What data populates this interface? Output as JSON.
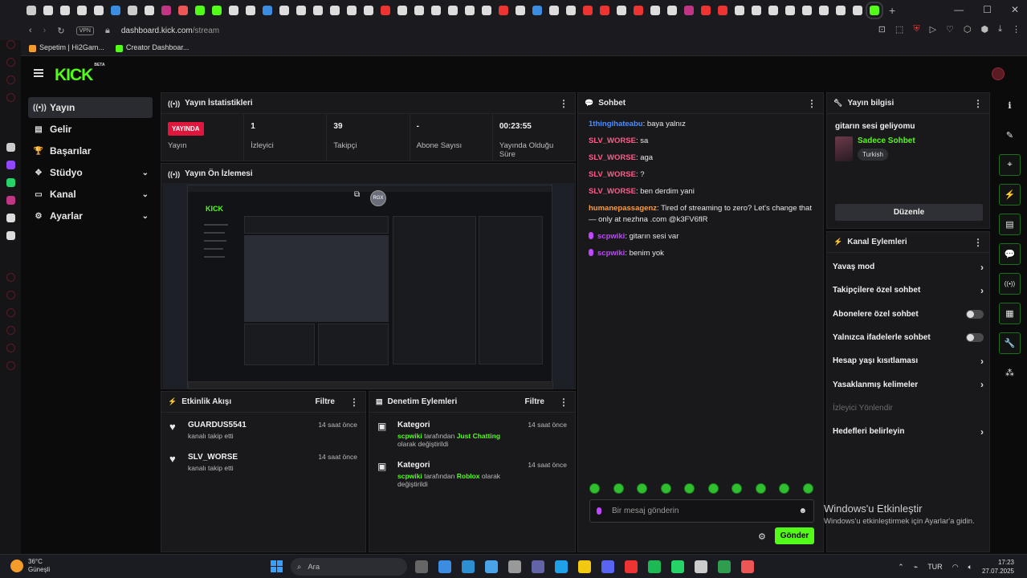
{
  "browser": {
    "vpn": "VPN",
    "url_host": "dashboard.kick.com",
    "url_path": "/stream",
    "bookmarks": [
      {
        "label": "Sepetim | Hi2Gam...",
        "color": "#f39c2b"
      },
      {
        "label": "Creator Dashboar...",
        "color": "#53fc18"
      }
    ],
    "tab_colors": [
      "#ccc",
      "#ddd",
      "#ddd",
      "#ddd",
      "#ddd",
      "#3a8de0",
      "#ccc",
      "#ddd",
      "#c13584",
      "#e55",
      "#53fc18",
      "#53fc18",
      "#ddd",
      "#ddd",
      "#3a8de0",
      "#ddd",
      "#ddd",
      "#ddd",
      "#ddd",
      "#ddd",
      "#ddd",
      "#e33",
      "#ddd",
      "#ddd",
      "#ddd",
      "#ddd",
      "#ddd",
      "#ddd",
      "#e33",
      "#ddd",
      "#3a8de0",
      "#ddd",
      "#ddd",
      "#e33",
      "#e33",
      "#ddd",
      "#e33",
      "#ddd",
      "#ddd",
      "#c13584",
      "#e33",
      "#e33",
      "#ddd",
      "#ddd",
      "#ddd",
      "#ddd",
      "#ddd",
      "#ddd",
      "#ddd",
      "#ddd",
      "#53fc18"
    ]
  },
  "brand": {
    "logo": "KICK",
    "beta": "BETA",
    "accent": "#53fc18",
    "live_color": "#e1163c"
  },
  "nav": [
    {
      "label": "Yayın",
      "icon": "broadcast-icon",
      "glyph": "((•))",
      "active": true,
      "chevron": false
    },
    {
      "label": "Gelir",
      "icon": "revenue-icon",
      "glyph": "▤",
      "active": false,
      "chevron": false
    },
    {
      "label": "Başarılar",
      "icon": "trophy-icon",
      "glyph": "🏆",
      "active": false,
      "chevron": false
    },
    {
      "label": "Stüdyo",
      "icon": "studio-icon",
      "glyph": "✥",
      "active": false,
      "chevron": true
    },
    {
      "label": "Kanal",
      "icon": "channel-icon",
      "glyph": "▭",
      "active": false,
      "chevron": true
    },
    {
      "label": "Ayarlar",
      "icon": "settings-icon",
      "glyph": "⚙",
      "active": false,
      "chevron": true
    }
  ],
  "stats": {
    "title": "Yayın İstatistikleri",
    "live_badge": "YAYINDA",
    "items": [
      {
        "value": "",
        "label": "Yayın"
      },
      {
        "value": "1",
        "label": "İzleyici"
      },
      {
        "value": "39",
        "label": "Takipçi"
      },
      {
        "value": "-",
        "label": "Abone Sayısı"
      },
      {
        "value": "00:23:55",
        "label": "Yayında Olduğu Süre"
      }
    ]
  },
  "preview": {
    "title": "Yayın Ön İzlemesi",
    "avatar_label": "RGX"
  },
  "activity": {
    "title": "Etkinlik Akışı",
    "filter": "Filtre",
    "events": [
      {
        "name": "GUARDUS5541",
        "desc": "kanalı takip etti",
        "time": "14 saat önce"
      },
      {
        "name": "SLV_WORSE",
        "desc": "kanalı takip etti",
        "time": "14 saat önce"
      }
    ]
  },
  "moderation": {
    "title": "Denetim Eylemleri",
    "filter": "Filtre",
    "events": [
      {
        "name": "Kategori",
        "user": "scpwiki",
        "pre": "tarafından",
        "target": "Just Chatting",
        "post": "olarak değiştirildi",
        "time": "14 saat önce"
      },
      {
        "name": "Kategori",
        "user": "scpwiki",
        "pre": "tarafından",
        "target": "Roblox",
        "post": "olarak değiştirildi",
        "time": "14 saat önce"
      }
    ]
  },
  "chat": {
    "title": "Sohbet",
    "messages": [
      {
        "user": "1thingihateabu",
        "color": "#4a8dff",
        "text": "baya yalnız",
        "mic": false
      },
      {
        "user": "SLV_WORSE",
        "color": "#ff5c8a",
        "text": "sa",
        "mic": false
      },
      {
        "user": "SLV_WORSE",
        "color": "#ff5c8a",
        "text": "aga",
        "mic": false
      },
      {
        "user": "SLV_WORSE",
        "color": "#ff5c8a",
        "text": "?",
        "mic": false
      },
      {
        "user": "SLV_WORSE",
        "color": "#ff5c8a",
        "text": "ben derdim yani",
        "mic": false
      },
      {
        "user": "humanepassagenz",
        "color": "#ff9d3a",
        "text": "Tired of streaming to zero? Let's change that — only at nezhna .com @k3FV6flR",
        "mic": false
      },
      {
        "user": "scpwiki",
        "color": "#c046ff",
        "text": "gitarın sesi var",
        "mic": true
      },
      {
        "user": "scpwiki",
        "color": "#c046ff",
        "text": "benim yok",
        "mic": true
      }
    ],
    "placeholder": "Bir mesaj gönderin",
    "send": "Gönder"
  },
  "info": {
    "title": "Yayın bilgisi",
    "stream_title": "gitarın sesi geliyomu",
    "category": "Sadece Sohbet",
    "tag": "Turkish",
    "edit": "Düzenle"
  },
  "channel_actions": {
    "title": "Kanal Eylemleri",
    "items": [
      {
        "label": "Yavaş mod",
        "kind": "arrow"
      },
      {
        "label": "Takipçilere özel sohbet",
        "kind": "arrow"
      },
      {
        "label": "Abonelere özel sohbet",
        "kind": "toggle"
      },
      {
        "label": "Yalnızca ifadelerle sohbet",
        "kind": "toggle"
      },
      {
        "label": "Hesap yaşı kısıtlaması",
        "kind": "arrow"
      },
      {
        "label": "Yasaklanmış kelimeler",
        "kind": "arrow"
      },
      {
        "label": "İzleyici Yönlendir",
        "kind": "dim"
      },
      {
        "label": "Hedefleri belirleyin",
        "kind": "arrow"
      }
    ]
  },
  "right_tools": [
    {
      "icon": "info-icon",
      "glyph": "ℹ",
      "box": false
    },
    {
      "icon": "edit-icon",
      "glyph": "✎",
      "box": false
    },
    {
      "icon": "target-icon",
      "glyph": "⌖",
      "box": true
    },
    {
      "icon": "bolt-icon",
      "glyph": "⚡",
      "box": true
    },
    {
      "icon": "notes-icon",
      "glyph": "▤",
      "box": true
    },
    {
      "icon": "chat-icon",
      "glyph": "💬",
      "box": true
    },
    {
      "icon": "signal-icon",
      "glyph": "((•))",
      "box": true
    },
    {
      "icon": "layout-icon",
      "glyph": "▦",
      "box": true
    },
    {
      "icon": "wrench-icon",
      "glyph": "🔧",
      "box": true
    },
    {
      "icon": "connect-icon",
      "glyph": "⁂",
      "box": false
    }
  ],
  "watermark": {
    "line1": "Windows'u Etkinleştir",
    "line2": "Windows'u etkinleştirmek için Ayarlar'a gidin."
  },
  "taskbar": {
    "temp": "36°C",
    "weather": "Güneşli",
    "search": "Ara",
    "lang": "TUR",
    "time": "17:23",
    "date": "27.07.2025",
    "apps": [
      "#666",
      "#3a8de0",
      "#2c8fd1",
      "#4aa3e8",
      "#999",
      "#6264a7",
      "#1ea1e8",
      "#f2c811",
      "#5865f2",
      "#e33",
      "#1db954",
      "#25d366",
      "#ccc",
      "#2e9e4e",
      "#e55"
    ]
  }
}
